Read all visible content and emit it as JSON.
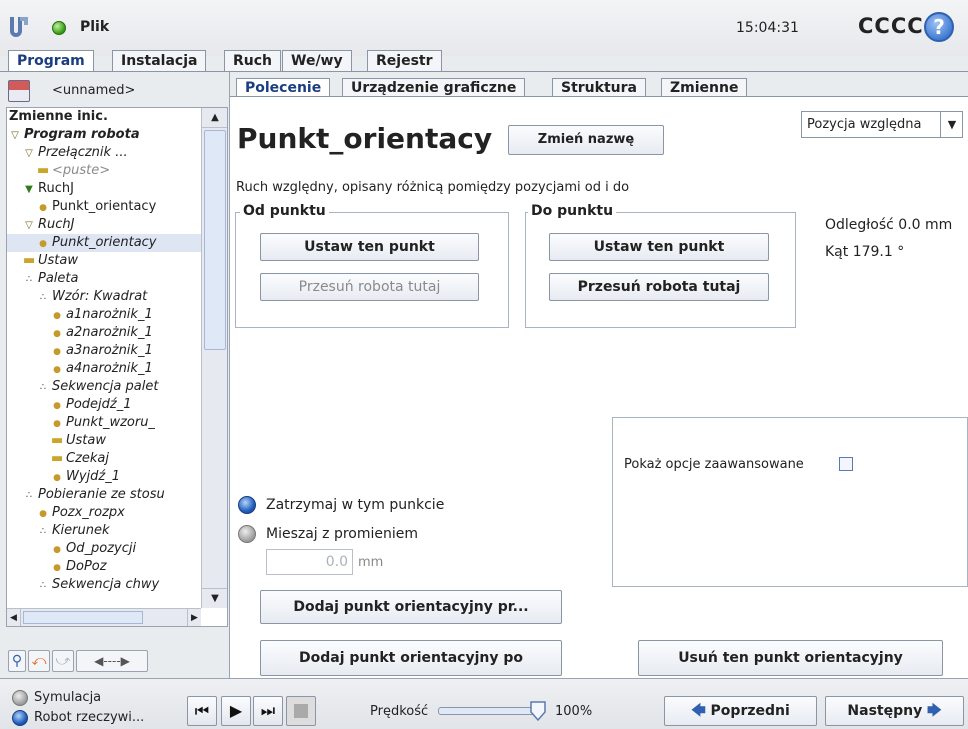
{
  "titlebar": {
    "file_label": "Plik",
    "clock": "15:04:31",
    "robot_name": "CCCC",
    "help_glyph": "?"
  },
  "main_tabs": [
    "Program",
    "Instalacja",
    "Ruch",
    "We/wy",
    "Rejestr"
  ],
  "left": {
    "program_name": "<unnamed>",
    "tree": [
      {
        "label": "Zmienne inic.",
        "style": "bold",
        "glyph": "",
        "indent": 0
      },
      {
        "label": "Program robota",
        "style": "bold-italic",
        "glyph": "tri",
        "indent": 0
      },
      {
        "label": "Przełącznik ...",
        "style": "italic",
        "glyph": "tri",
        "indent": 1
      },
      {
        "label": "<puste>",
        "style": "italic-gray",
        "glyph": "dash",
        "indent": 2
      },
      {
        "label": "RuchJ",
        "style": "normal",
        "glyph": "move",
        "indent": 1
      },
      {
        "label": "Punkt_orientacy",
        "style": "normal",
        "glyph": "wp",
        "indent": 2
      },
      {
        "label": "RuchJ",
        "style": "italic",
        "glyph": "tri",
        "indent": 1
      },
      {
        "label": "Punkt_orientacy",
        "style": "italic-selected",
        "glyph": "wp",
        "indent": 2
      },
      {
        "label": "Ustaw",
        "style": "italic",
        "glyph": "dash",
        "indent": 1
      },
      {
        "label": "Paleta",
        "style": "italic",
        "glyph": "pal",
        "indent": 1
      },
      {
        "label": "Wzór: Kwadrat",
        "style": "italic",
        "glyph": "pal",
        "indent": 2
      },
      {
        "label": "a1narożnik_1",
        "style": "italic",
        "glyph": "wp",
        "indent": 3
      },
      {
        "label": "a2narożnik_1",
        "style": "italic",
        "glyph": "wp",
        "indent": 3
      },
      {
        "label": "a3narożnik_1",
        "style": "italic",
        "glyph": "wp",
        "indent": 3
      },
      {
        "label": "a4narożnik_1",
        "style": "italic",
        "glyph": "wp",
        "indent": 3
      },
      {
        "label": "Sekwencja palet",
        "style": "italic",
        "glyph": "pal",
        "indent": 2
      },
      {
        "label": "Podejdź_1",
        "style": "italic",
        "glyph": "wp",
        "indent": 3
      },
      {
        "label": "Punkt_wzoru_",
        "style": "italic",
        "glyph": "wp",
        "indent": 3
      },
      {
        "label": "Ustaw",
        "style": "italic",
        "glyph": "dash",
        "indent": 3
      },
      {
        "label": "Czekaj",
        "style": "italic",
        "glyph": "dash",
        "indent": 3
      },
      {
        "label": "Wyjdź_1",
        "style": "italic",
        "glyph": "wp",
        "indent": 3
      },
      {
        "label": "Pobieranie ze stosu",
        "style": "italic",
        "glyph": "pal",
        "indent": 1
      },
      {
        "label": "Pozx_rozpx",
        "style": "italic",
        "glyph": "wp",
        "indent": 2
      },
      {
        "label": "Kierunek",
        "style": "italic",
        "glyph": "pal",
        "indent": 2
      },
      {
        "label": "Od_pozycji",
        "style": "italic",
        "glyph": "wp",
        "indent": 3
      },
      {
        "label": "DoPoz",
        "style": "italic",
        "glyph": "wp",
        "indent": 3
      },
      {
        "label": "Sekwencja chwy",
        "style": "italic",
        "glyph": "pal",
        "indent": 2
      }
    ]
  },
  "sub_tabs": [
    "Polecenie",
    "Urządzenie graficzne",
    "Struktura",
    "Zmienne"
  ],
  "command": {
    "title": "Punkt_orientacy",
    "rename_button": "Zmień nazwę",
    "position_select": "Pozycja względna",
    "description": "Ruch względny, opisany różnicą pomiędzy pozycjami od i do",
    "from_group": {
      "title": "Od punktu",
      "set_button": "Ustaw ten punkt",
      "move_button": "Przesuń robota tutaj"
    },
    "to_group": {
      "title": "Do punktu",
      "set_button": "Ustaw ten punkt",
      "move_button": "Przesuń robota tutaj"
    },
    "distance": "Odległość 0.0 mm",
    "angle": "Kąt 179.1 °",
    "advanced_label": "Pokaż opcje zaawansowane",
    "stop_label": "Zatrzymaj w tym punkcie",
    "blend_label": "Mieszaj z promieniem",
    "radius_value": "0.0",
    "radius_unit": "mm",
    "add_before_button": "Dodaj punkt orientacyjny pr...",
    "add_after_button": "Dodaj punkt orientacyjny po",
    "delete_button": "Usuń ten punkt orientacyjny"
  },
  "bottom": {
    "simulation_label": "Symulacja",
    "robot_label": "Robot rzeczywi...",
    "speed_label": "Prędkość",
    "speed_value": "100%",
    "speed_fraction": 1.0,
    "prev_button": "Poprzedni",
    "next_button": "Następny"
  },
  "colors": {
    "accent": "#1b3e80",
    "status_green": "#2f9a0e",
    "help_blue": "#3c78d0"
  }
}
